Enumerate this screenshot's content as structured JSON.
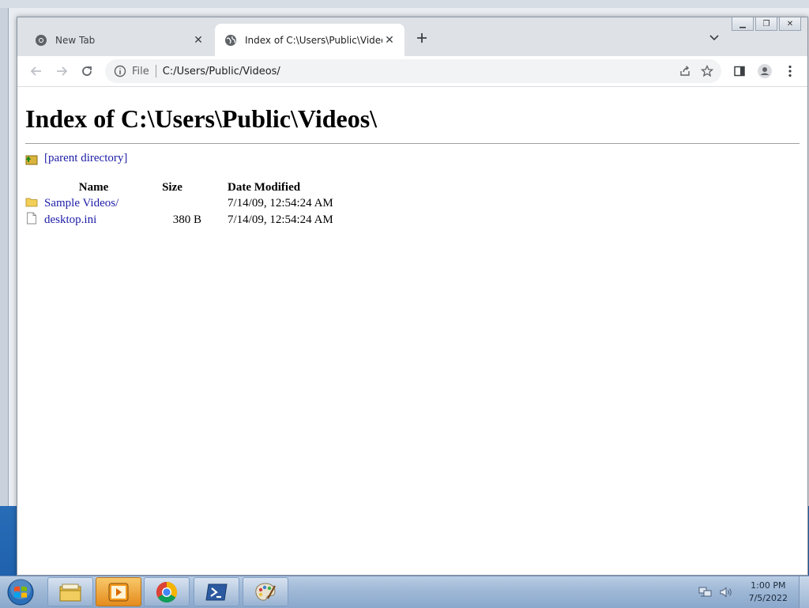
{
  "tabs": [
    {
      "title": "New Tab",
      "active": false
    },
    {
      "title": "Index of C:\\Users\\Public\\Videos\\",
      "active": true
    }
  ],
  "omnibox": {
    "scheme": "File",
    "url": "C:/Users/Public/Videos/"
  },
  "page": {
    "heading": "Index of C:\\Users\\Public\\Videos\\",
    "parent_link": "[parent directory]",
    "columns": {
      "name": "Name",
      "size": "Size",
      "date": "Date Modified"
    },
    "rows": [
      {
        "name": "Sample Videos/",
        "size": "",
        "date": "7/14/09, 12:54:24 AM",
        "type": "folder"
      },
      {
        "name": "desktop.ini",
        "size": "380 B",
        "date": "7/14/09, 12:54:24 AM",
        "type": "file"
      }
    ]
  },
  "taskbar": {
    "apps": [
      "file-explorer",
      "media-player",
      "chrome",
      "powershell",
      "paint"
    ],
    "time": "1:00 PM",
    "date": "7/5/2022"
  },
  "colors": {
    "link": "#1c1ca8",
    "tabstrip": "#dee1e6",
    "omnibox": "#f1f3f4"
  }
}
